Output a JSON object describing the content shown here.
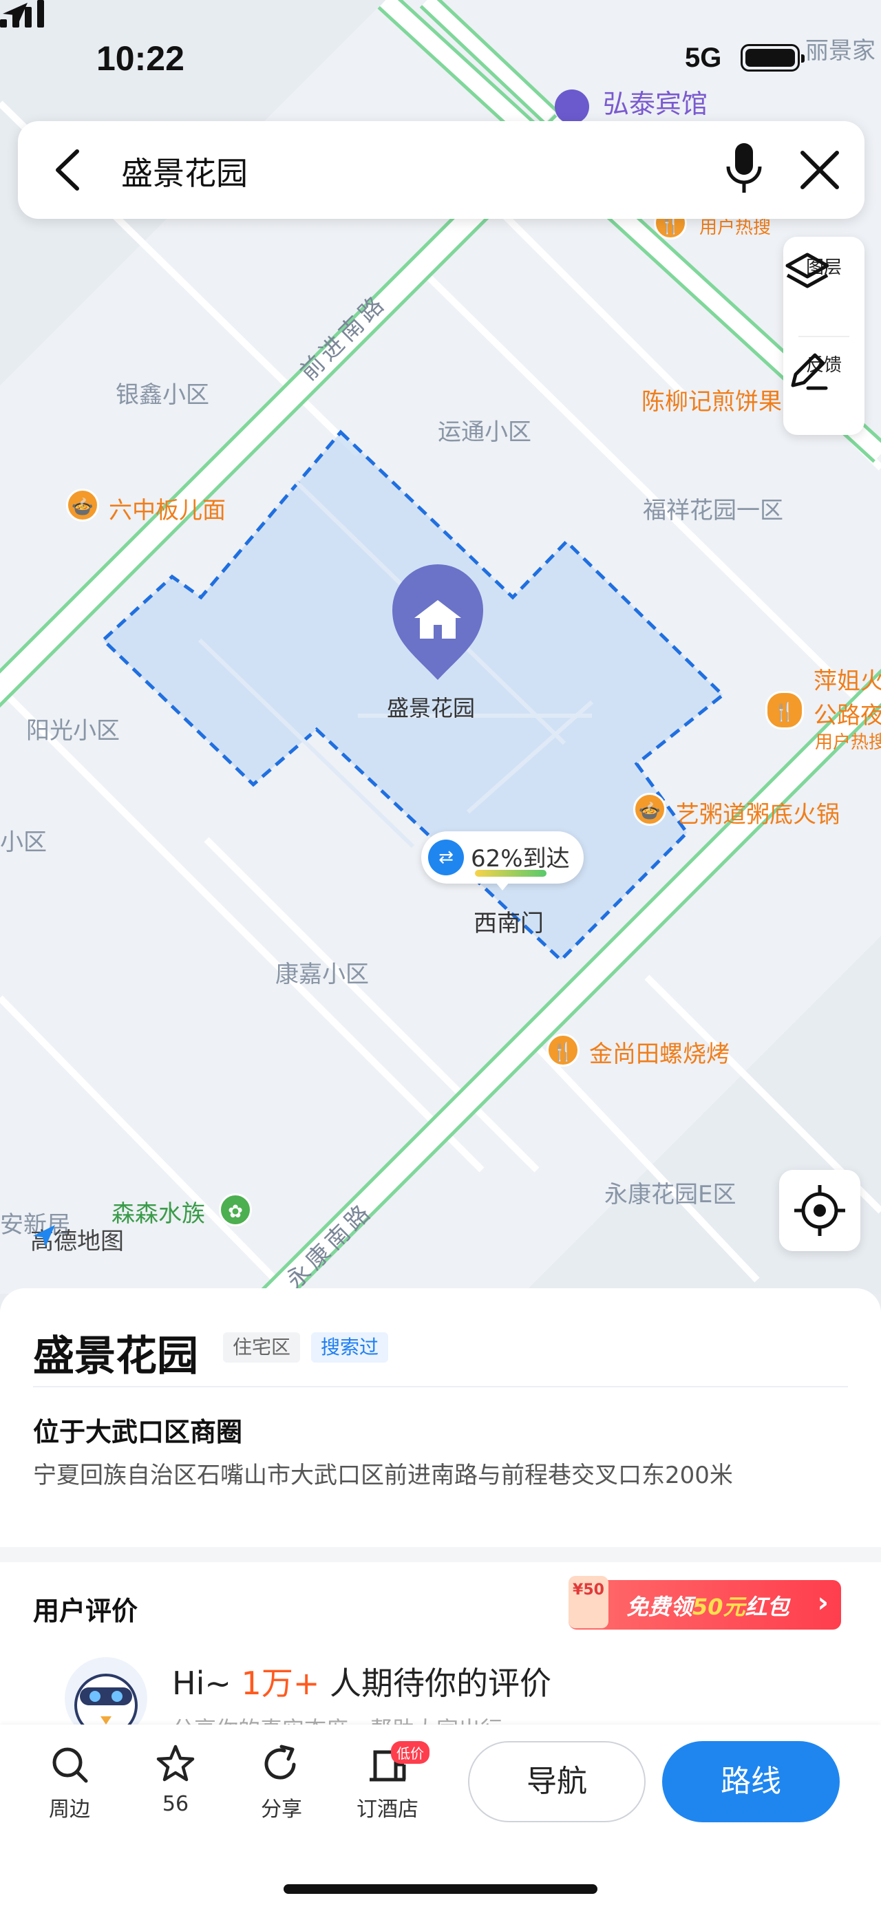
{
  "status_bar": {
    "time": "10:22",
    "network": "5G"
  },
  "search": {
    "query": "盛景花园"
  },
  "map_tools": {
    "layers_label": "图层",
    "feedback_label": "反馈"
  },
  "map": {
    "top_hotel": "弘泰宾馆",
    "top_right_label": "丽景家",
    "hot_search": "用户热搜",
    "road_qianjin": "前进南路",
    "road_yongkang": "永康南路",
    "areas": {
      "yinxin": "银鑫小区",
      "yuntong": "运通小区",
      "fuxiang": "福祥花园一区",
      "yangguang": "阳光小区",
      "kangjia": "康嘉小区",
      "yongkang_e": "永康花园E区",
      "left_edge": "小区",
      "anxin": "安新居"
    },
    "pois": {
      "liuzhong": "六中板儿面",
      "chenliuji": "陈柳记煎饼果",
      "pingjie": "萍姐火",
      "pingjie_sub": "公路夜",
      "pingjie_hot": "用户热搜",
      "yizhou": "艺粥道粥底火锅",
      "jinshangtian": "金尚田螺烧烤",
      "sensen": "森森水族"
    },
    "place_label": "盛景花园",
    "gate_label": "西南门",
    "eta_text": "62%到达",
    "logo": "高德地图"
  },
  "sheet": {
    "name": "盛景花园",
    "tag_type": "住宅区",
    "tag_searched": "搜索过",
    "area_title": "位于大武口区商圈",
    "address": "宁夏回族自治区石嘴山市大武口区前进南路与前程巷交叉口东200米",
    "review_title": "用户评价",
    "coupon_badge": "¥50",
    "coupon_pre": "免费领",
    "coupon_amount": "50元",
    "coupon_post": "红包",
    "invite_pre": "Hi~ ",
    "invite_hl": "1万+",
    "invite_post": " 人期待你的评价",
    "invite_sub": "分享你的真实态度，帮助大家出行"
  },
  "actions": {
    "nearby": "周边",
    "favorites_count": "56",
    "share": "分享",
    "hotel": "订酒店",
    "hotel_badge": "低价",
    "navigate": "导航",
    "route": "路线"
  },
  "colors": {
    "accent": "#1f86f0",
    "poi_orange": "#f07d1a",
    "boundary": "#1f6fe0"
  }
}
